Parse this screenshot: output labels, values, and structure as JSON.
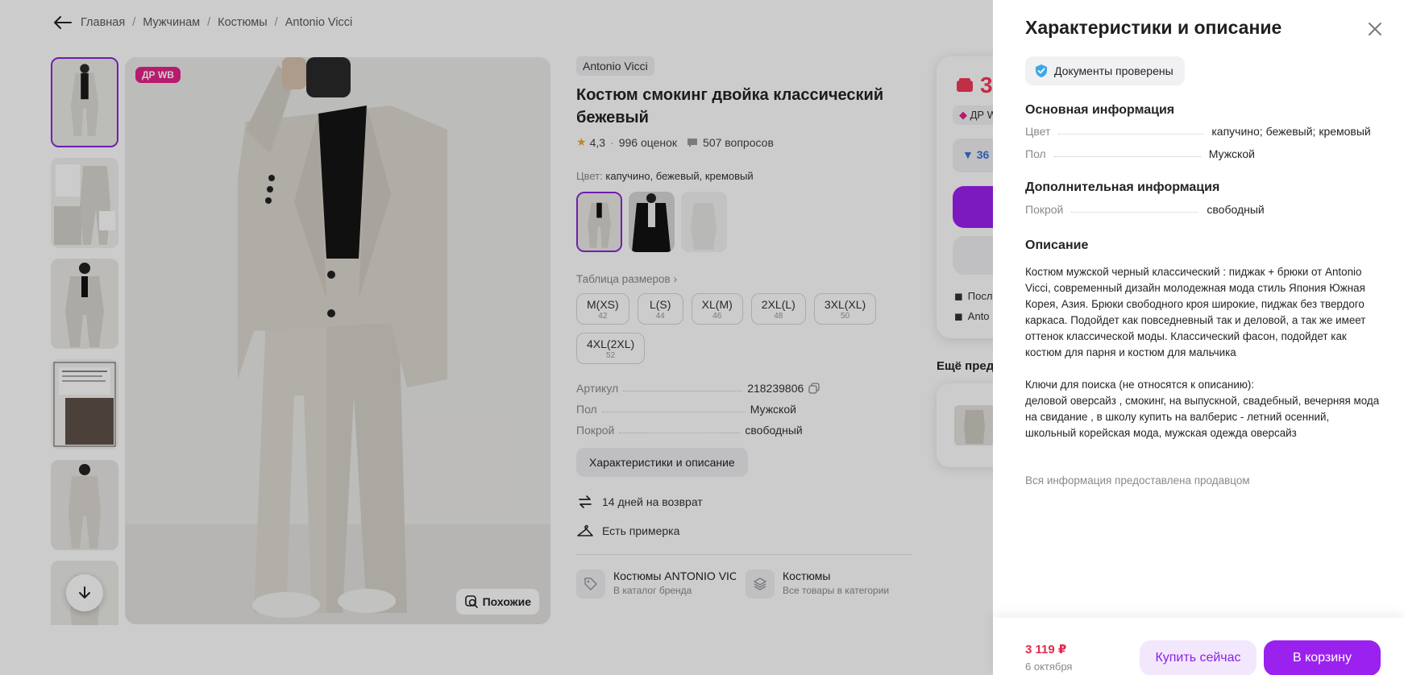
{
  "breadcrumbs": [
    "Главная",
    "Мужчинам",
    "Костюмы",
    "Antonio Vicci"
  ],
  "gallery": {
    "badge": "ДР WB",
    "similar_label": "Похожие"
  },
  "product": {
    "brand": "Antonio Vicci",
    "title": "Костюм смокинг двойка классический бежевый",
    "rating": "4,3",
    "reviews": "996 оценок",
    "questions": "507 вопросов",
    "color_label": "Цвет:",
    "color_value": "капучино, бежевый, кремовый",
    "size_table_label": "Таблица размеров",
    "sizes": [
      {
        "size": "M(XS)",
        "num": "42"
      },
      {
        "size": "L(S)",
        "num": "44"
      },
      {
        "size": "XL(M)",
        "num": "46"
      },
      {
        "size": "2XL(L)",
        "num": "48"
      },
      {
        "size": "3XL(XL)",
        "num": "50"
      },
      {
        "size": "4XL(2XL)",
        "num": "52"
      }
    ],
    "specs": [
      {
        "key": "Артикул",
        "value": "218239806"
      },
      {
        "key": "Пол",
        "value": "Мужской"
      },
      {
        "key": "Покрой",
        "value": "свободный"
      }
    ],
    "chars_button": "Характеристики и описание",
    "perks": [
      "14 дней на возврат",
      "Есть примерка"
    ],
    "categories": [
      {
        "title": "Костюмы ANTONIO VICCI",
        "subtitle": "В каталог бренда"
      },
      {
        "title": "Костюмы",
        "subtitle": "Все товары в категории"
      }
    ]
  },
  "buy_card": {
    "price_partial": "3",
    "dr_partial": "ДР W",
    "discount_partial": "▼ 36",
    "line1": "Посл",
    "line2": "Anto"
  },
  "more_title_partial": "Ещё пред",
  "panel": {
    "title": "Характеристики и описание",
    "docs_label": "Документы проверены",
    "main_info_title": "Основная информация",
    "main_info": [
      {
        "key": "Цвет",
        "value": "капучино; бежевый; кремовый"
      },
      {
        "key": "Пол",
        "value": "Мужской"
      }
    ],
    "extra_info_title": "Дополнительная информация",
    "extra_info": [
      {
        "key": "Покрой",
        "value": "свободный"
      }
    ],
    "description_title": "Описание",
    "description": "Костюм мужской черный классический : пиджак + брюки от Antonio Vicci, современный дизайн молодежная мода стиль Япония Южная Корея, Азия. Брюки свободного кроя широкие, пиджак без твердого каркаса. Подойдет как повседневный так и деловой, а так же имеет оттенок классической моды. Классический фасон, подойдет как костюм для парня и костюм для мальчика",
    "keywords": "Ключи для поиска (не относятся к описанию):\nделовой оверсайз , смокинг, на выпускной, свадебный, вечерняя мода на свидание , в школу купить на валберис - летний осенний, школьный корейская мода, мужская одежда оверсайз",
    "seller_note": "Вся информация предоставлена продавцом",
    "footer": {
      "price": "3 119 ₽",
      "date": "6 октября",
      "buy_now": "Купить сейчас",
      "add_to_cart": "В корзину"
    }
  },
  "colors": {
    "accent": "#9b21ef",
    "price": "#e22b4b",
    "badge": "#e5218a"
  }
}
